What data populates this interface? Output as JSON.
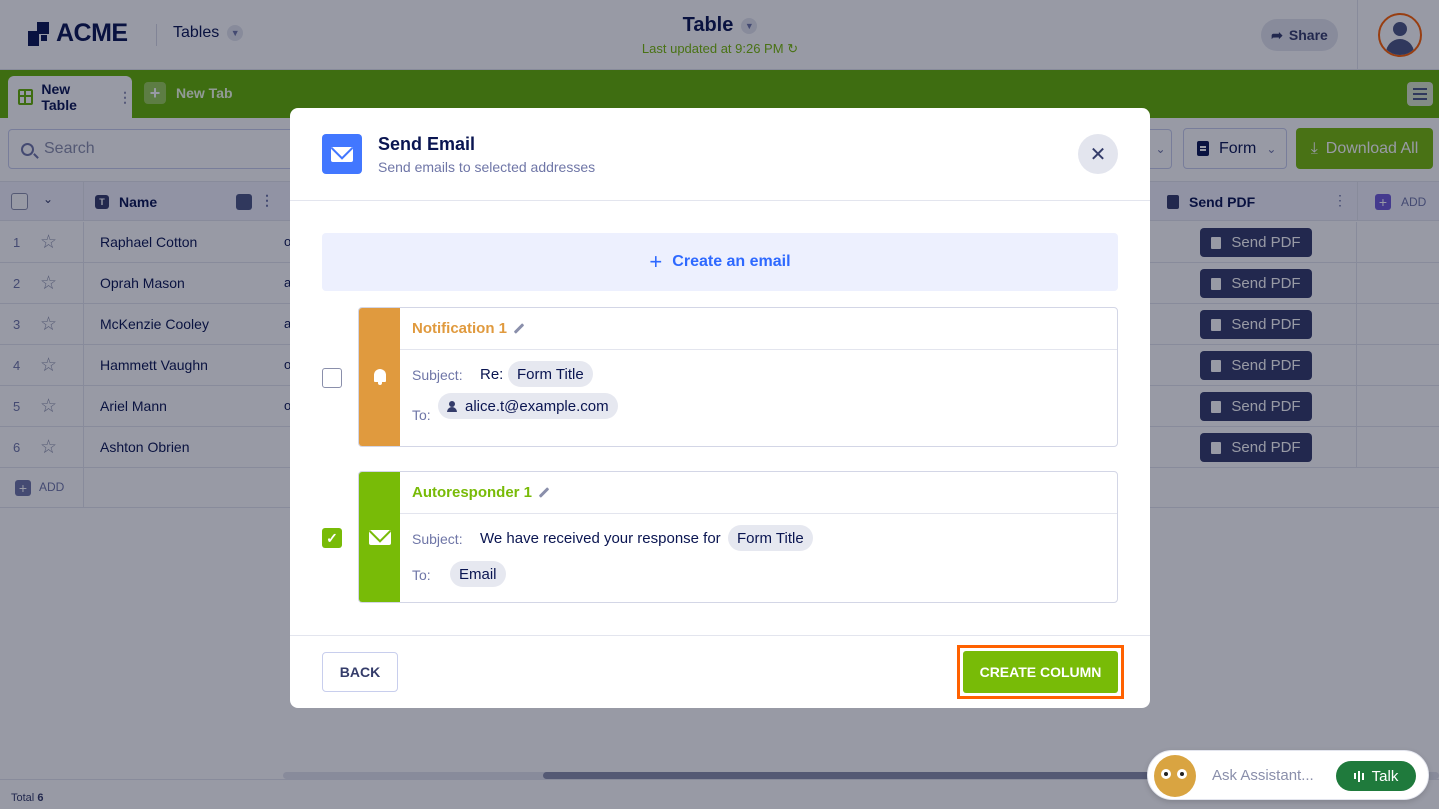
{
  "header": {
    "logo_text": "ACME",
    "tables_menu": "Tables",
    "title": "Table",
    "last_updated": "Last updated at 9:26 PM",
    "share_label": "Share"
  },
  "tabs": {
    "active_label": "New Table",
    "new_tab_label": "New Tab"
  },
  "toolbar": {
    "search_placeholder": "Search",
    "form_label": "Form",
    "download_label": "Download All"
  },
  "table": {
    "columns": {
      "name": "Name",
      "send_pdf": "Send PDF",
      "add": "ADD"
    },
    "rows": [
      {
        "num": "1",
        "name": "Raphael Cotton",
        "frag": "o",
        "button": "Send PDF"
      },
      {
        "num": "2",
        "name": "Oprah Mason",
        "frag": "a",
        "button": "Send PDF"
      },
      {
        "num": "3",
        "name": "McKenzie Cooley",
        "frag": "a",
        "button": "Send PDF"
      },
      {
        "num": "4",
        "name": "Hammett Vaughn",
        "frag": "o",
        "button": "Send PDF"
      },
      {
        "num": "5",
        "name": "Ariel Mann",
        "frag": "o",
        "button": "Send PDF"
      },
      {
        "num": "6",
        "name": "Ashton Obrien",
        "frag": "",
        "button": "Send PDF"
      }
    ],
    "add_row_label": "ADD"
  },
  "footer": {
    "total_label": "Total",
    "total_value": "6"
  },
  "assistant": {
    "placeholder": "Ask Assistant...",
    "talk_label": "Talk"
  },
  "modal": {
    "title": "Send Email",
    "subtitle": "Send emails to selected addresses",
    "close_icon": "close-icon",
    "create_email_label": "Create an email",
    "cards": [
      {
        "title": "Notification 1",
        "color": "#e09a3e",
        "icon": "bell-icon",
        "checked": false,
        "subject_label": "Subject:",
        "subject_prefix": "Re:",
        "subject_chip": "Form Title",
        "to_label": "To:",
        "to_chip": "alice.t@example.com"
      },
      {
        "title": "Autoresponder 1",
        "color": "#78bb07",
        "icon": "envelope-icon",
        "checked": true,
        "subject_label": "Subject:",
        "subject_text": "We have received your response for",
        "subject_chip": "Form Title",
        "to_label": "To:",
        "to_chip": "Email"
      }
    ],
    "back_label": "BACK",
    "create_column_label": "CREATE COLUMN"
  },
  "colors": {
    "brand_green": "#64b200",
    "accent_blue": "#4277ff",
    "highlight_orange": "#ff6100",
    "notification_orange": "#e09a3e",
    "autoresponder_green": "#78bb07"
  }
}
